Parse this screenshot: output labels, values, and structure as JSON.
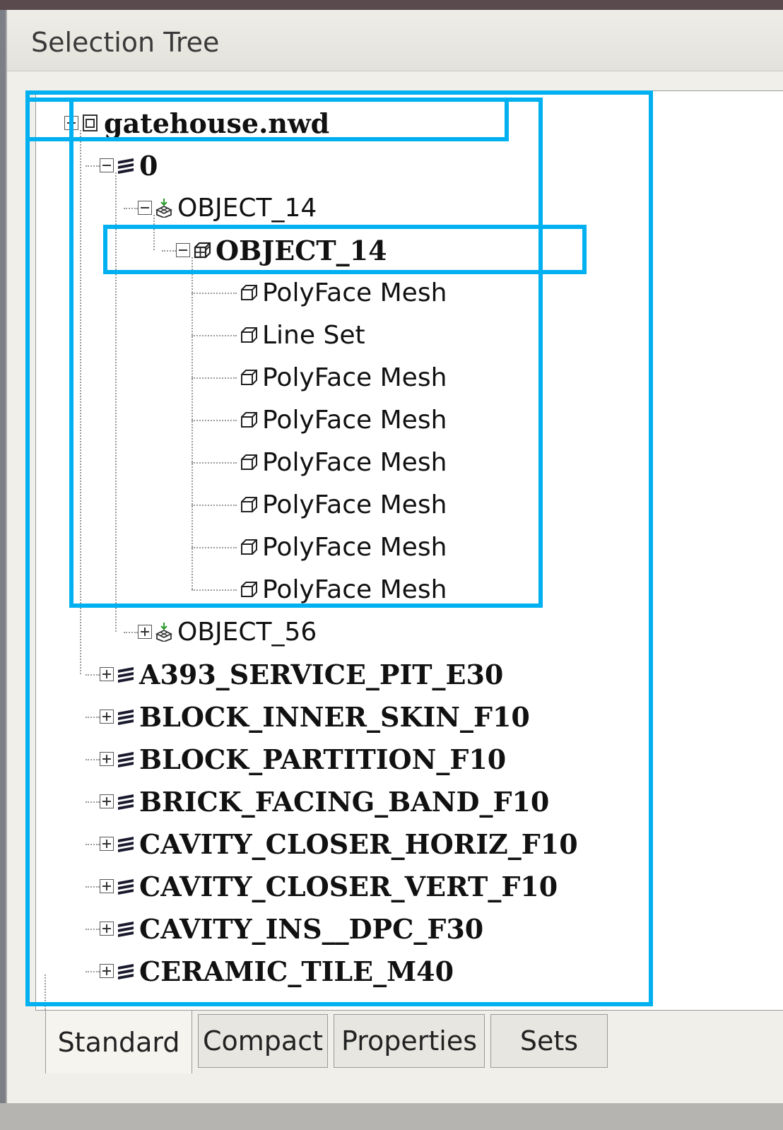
{
  "window": {
    "title": "Selection Tree"
  },
  "tree": [
    {
      "label": "gatehouse.nwd",
      "icon": "file-icon",
      "expanded": true,
      "bold": true
    },
    {
      "label": "0",
      "icon": "layer-icon",
      "expanded": true,
      "bold": true
    },
    {
      "label": "OBJECT_14",
      "icon": "insert-group-icon",
      "expanded": true,
      "bold": false
    },
    {
      "label": "OBJECT_14",
      "icon": "composite-object-icon",
      "expanded": true,
      "bold": true
    },
    {
      "label": "PolyFace Mesh",
      "icon": "geometry-icon"
    },
    {
      "label": "Line Set",
      "icon": "geometry-icon"
    },
    {
      "label": "PolyFace Mesh",
      "icon": "geometry-icon"
    },
    {
      "label": "PolyFace Mesh",
      "icon": "geometry-icon"
    },
    {
      "label": "PolyFace Mesh",
      "icon": "geometry-icon"
    },
    {
      "label": "PolyFace Mesh",
      "icon": "geometry-icon"
    },
    {
      "label": "PolyFace Mesh",
      "icon": "geometry-icon"
    },
    {
      "label": "PolyFace Mesh",
      "icon": "geometry-icon"
    },
    {
      "label": "OBJECT_56",
      "icon": "insert-group-icon",
      "expanded": false,
      "bold": false
    },
    {
      "label": "A393_SERVICE_PIT_E30",
      "icon": "layer-icon",
      "expanded": false,
      "bold": true
    },
    {
      "label": "BLOCK_INNER_SKIN_F10",
      "icon": "layer-icon",
      "expanded": false,
      "bold": true
    },
    {
      "label": "BLOCK_PARTITION_F10",
      "icon": "layer-icon",
      "expanded": false,
      "bold": true
    },
    {
      "label": "BRICK_FACING_BAND_F10",
      "icon": "layer-icon",
      "expanded": false,
      "bold": true
    },
    {
      "label": "CAVITY_CLOSER_HORIZ_F10",
      "icon": "layer-icon",
      "expanded": false,
      "bold": true
    },
    {
      "label": "CAVITY_CLOSER_VERT_F10",
      "icon": "layer-icon",
      "expanded": false,
      "bold": true
    },
    {
      "label": "CAVITY_INS__DPC_F30",
      "icon": "layer-icon",
      "expanded": false,
      "bold": true
    },
    {
      "label": "CERAMIC_TILE_M40",
      "icon": "layer-icon",
      "expanded": false,
      "bold": true
    }
  ],
  "tabs": [
    {
      "label": "Standard",
      "active": true
    },
    {
      "label": "Compact",
      "active": false
    },
    {
      "label": "Properties",
      "active": false
    },
    {
      "label": "Sets",
      "active": false
    }
  ],
  "colors": {
    "highlight": "#00b0f0",
    "callout": "#f6b7bb",
    "layer_icon": "#1a1a2e"
  }
}
